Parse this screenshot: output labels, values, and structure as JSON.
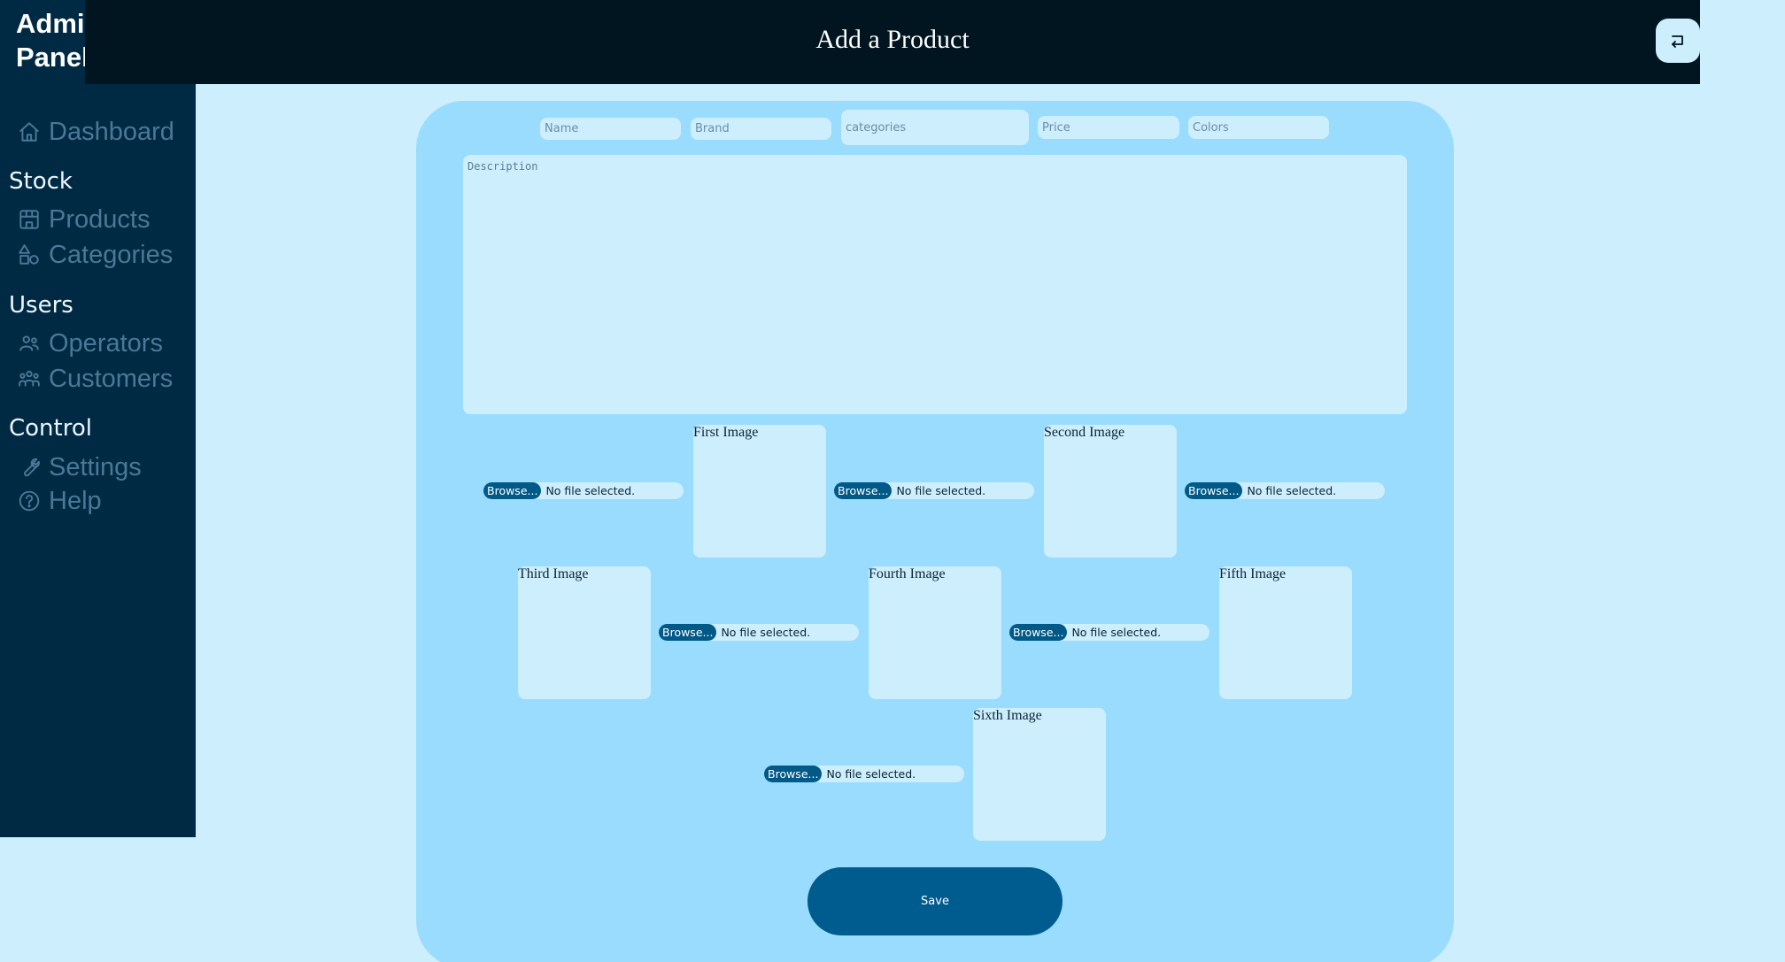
{
  "app": {
    "title": "Admin\nPanel"
  },
  "header": {
    "title": "Add a Product",
    "back_icon": "back-arrow-icon"
  },
  "sidebar": {
    "items": [
      {
        "label": "Dashboard",
        "icon": "home-icon"
      }
    ],
    "sections": [
      {
        "title": "Stock",
        "items": [
          {
            "label": "Products",
            "icon": "store-icon"
          },
          {
            "label": "Categories",
            "icon": "shapes-icon"
          }
        ]
      },
      {
        "title": "Users",
        "items": [
          {
            "label": "Operators",
            "icon": "users-icon"
          },
          {
            "label": "Customers",
            "icon": "users-group-icon"
          }
        ]
      },
      {
        "title": "Control",
        "items": [
          {
            "label": "Settings",
            "icon": "wrench-icon"
          },
          {
            "label": "Help",
            "icon": "help-circle-icon"
          }
        ]
      }
    ]
  },
  "form": {
    "fields": {
      "name": "Name",
      "brand": "Brand",
      "categories": "categories",
      "price": "Price",
      "colors": "Colors",
      "description": "Description"
    },
    "file_inputs": [
      {
        "button": "Browse...",
        "status": "No file selected."
      },
      {
        "button": "Browse...",
        "status": "No file selected."
      },
      {
        "button": "Browse...",
        "status": "No file selected."
      },
      {
        "button": "Browse...",
        "status": "No file selected."
      },
      {
        "button": "Browse...",
        "status": "No file selected."
      },
      {
        "button": "Browse...",
        "status": "No file selected."
      }
    ],
    "images": [
      "First Image",
      "Second Image",
      "Third Image",
      "Fourth Image",
      "Fifth Image",
      "Sixth Image"
    ],
    "save_label": "Save"
  },
  "colors": {
    "sidebar_bg": "#002a43",
    "header_bg": "#00151f",
    "page_bg": "#cdeefd",
    "card_bg": "#99dcfd",
    "accent": "#005b8e",
    "nav_text": "#4b7897"
  }
}
